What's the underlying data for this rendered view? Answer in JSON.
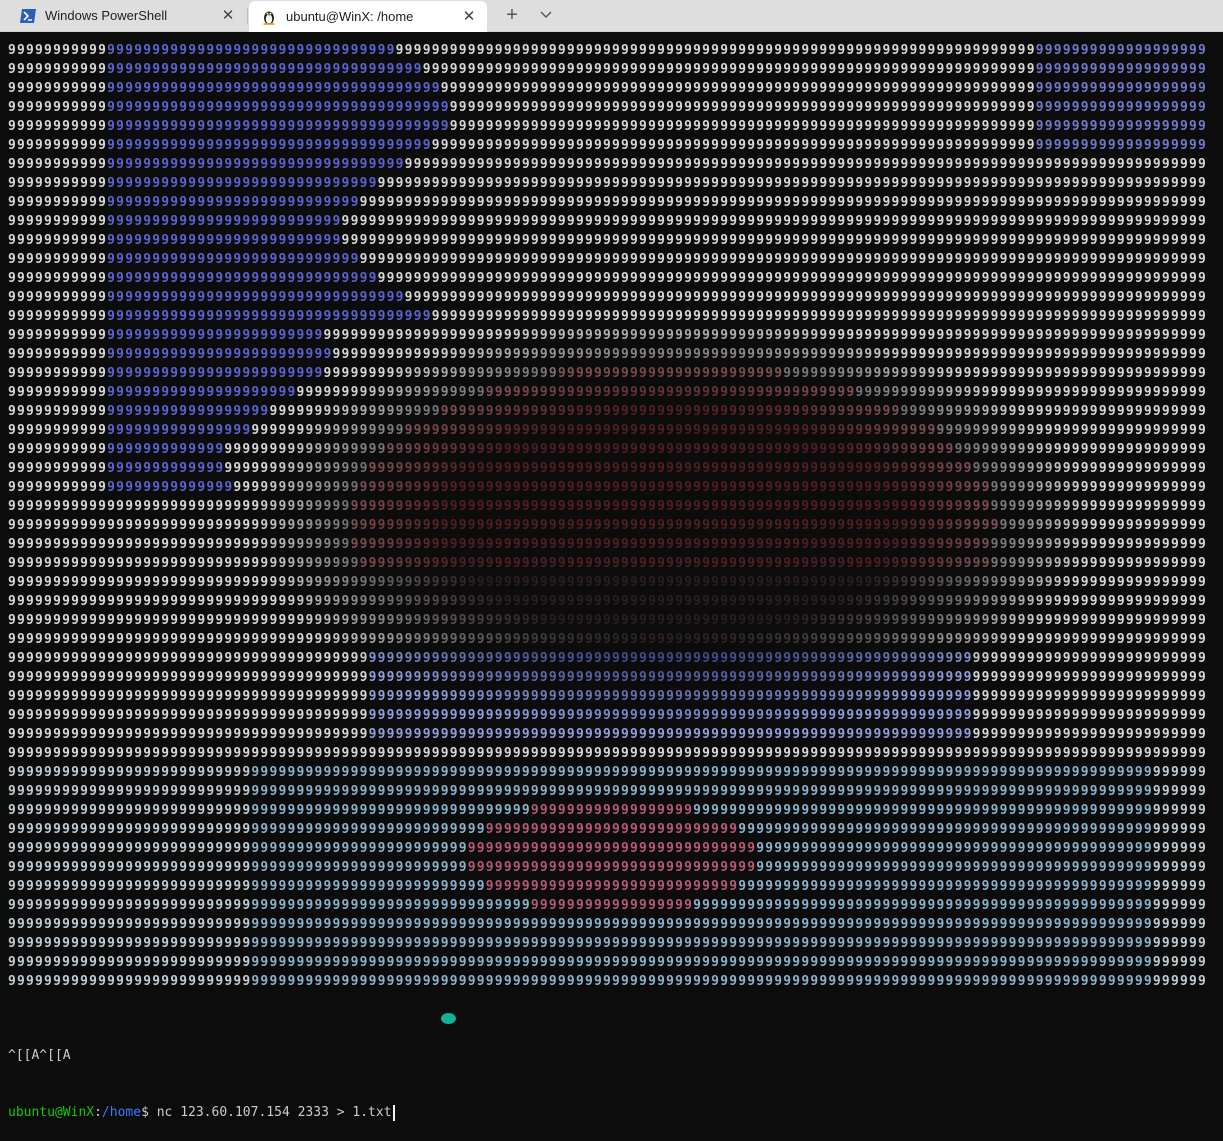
{
  "tabs": [
    {
      "title": "Windows PowerShell",
      "icon": "powershell-icon",
      "active": false
    },
    {
      "title": "ubuntu@WinX: /home",
      "icon": "linux-penguin-icon",
      "active": true
    }
  ],
  "terminal": {
    "art_char": "9",
    "art_rows": 50,
    "art_cols": 133,
    "output_line": "^[[A^[[A",
    "prompt_user": "ubuntu@WinX",
    "prompt_sep": ":",
    "prompt_path": "/home",
    "prompt_symbol": "$ ",
    "command": "nc 123.60.107.154 2333 > 1.txt"
  },
  "colors": {
    "background": "#0c0c0c",
    "text": "#cccccc",
    "prompt_user": "#16c60c",
    "prompt_path": "#3b78ff"
  }
}
